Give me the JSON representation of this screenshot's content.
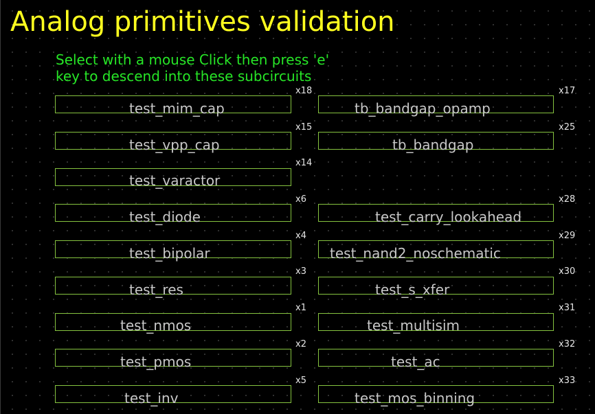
{
  "title": "Analog primitives validation",
  "instructions": [
    "Select with a mouse Click then press 'e'",
    "key to descend into these subcircuits"
  ],
  "left_column": [
    {
      "instance": "x18",
      "name": "test_mim_cap"
    },
    {
      "instance": "x15",
      "name": "test_vpp_cap"
    },
    {
      "instance": "x14",
      "name": "test_varactor"
    },
    {
      "instance": "x6",
      "name": "test_diode"
    },
    {
      "instance": "x4",
      "name": "test_bipolar"
    },
    {
      "instance": "x3",
      "name": "test_res"
    },
    {
      "instance": "x1",
      "name": "test_nmos"
    },
    {
      "instance": "x2",
      "name": "test_pmos"
    },
    {
      "instance": "x5",
      "name": "test_inv"
    }
  ],
  "right_column": [
    {
      "instance": "x17",
      "name": "tb_bandgap_opamp"
    },
    {
      "instance": "x25",
      "name": "tb_bandgap"
    },
    {
      "instance": "x28",
      "name": "test_carry_lookahead"
    },
    {
      "instance": "x29",
      "name": "test_nand2_noschematic"
    },
    {
      "instance": "x30",
      "name": "test_s_xfer"
    },
    {
      "instance": "x31",
      "name": "test_multisim"
    },
    {
      "instance": "x32",
      "name": "test_ac"
    },
    {
      "instance": "x33",
      "name": "test_mos_binning"
    }
  ],
  "colors": {
    "background": "#000000",
    "title": "#ffff1f",
    "instructions": "#27e627",
    "box_border": "#86c440",
    "label": "#c8c8c8",
    "instance_tag": "#e6e6e6"
  }
}
